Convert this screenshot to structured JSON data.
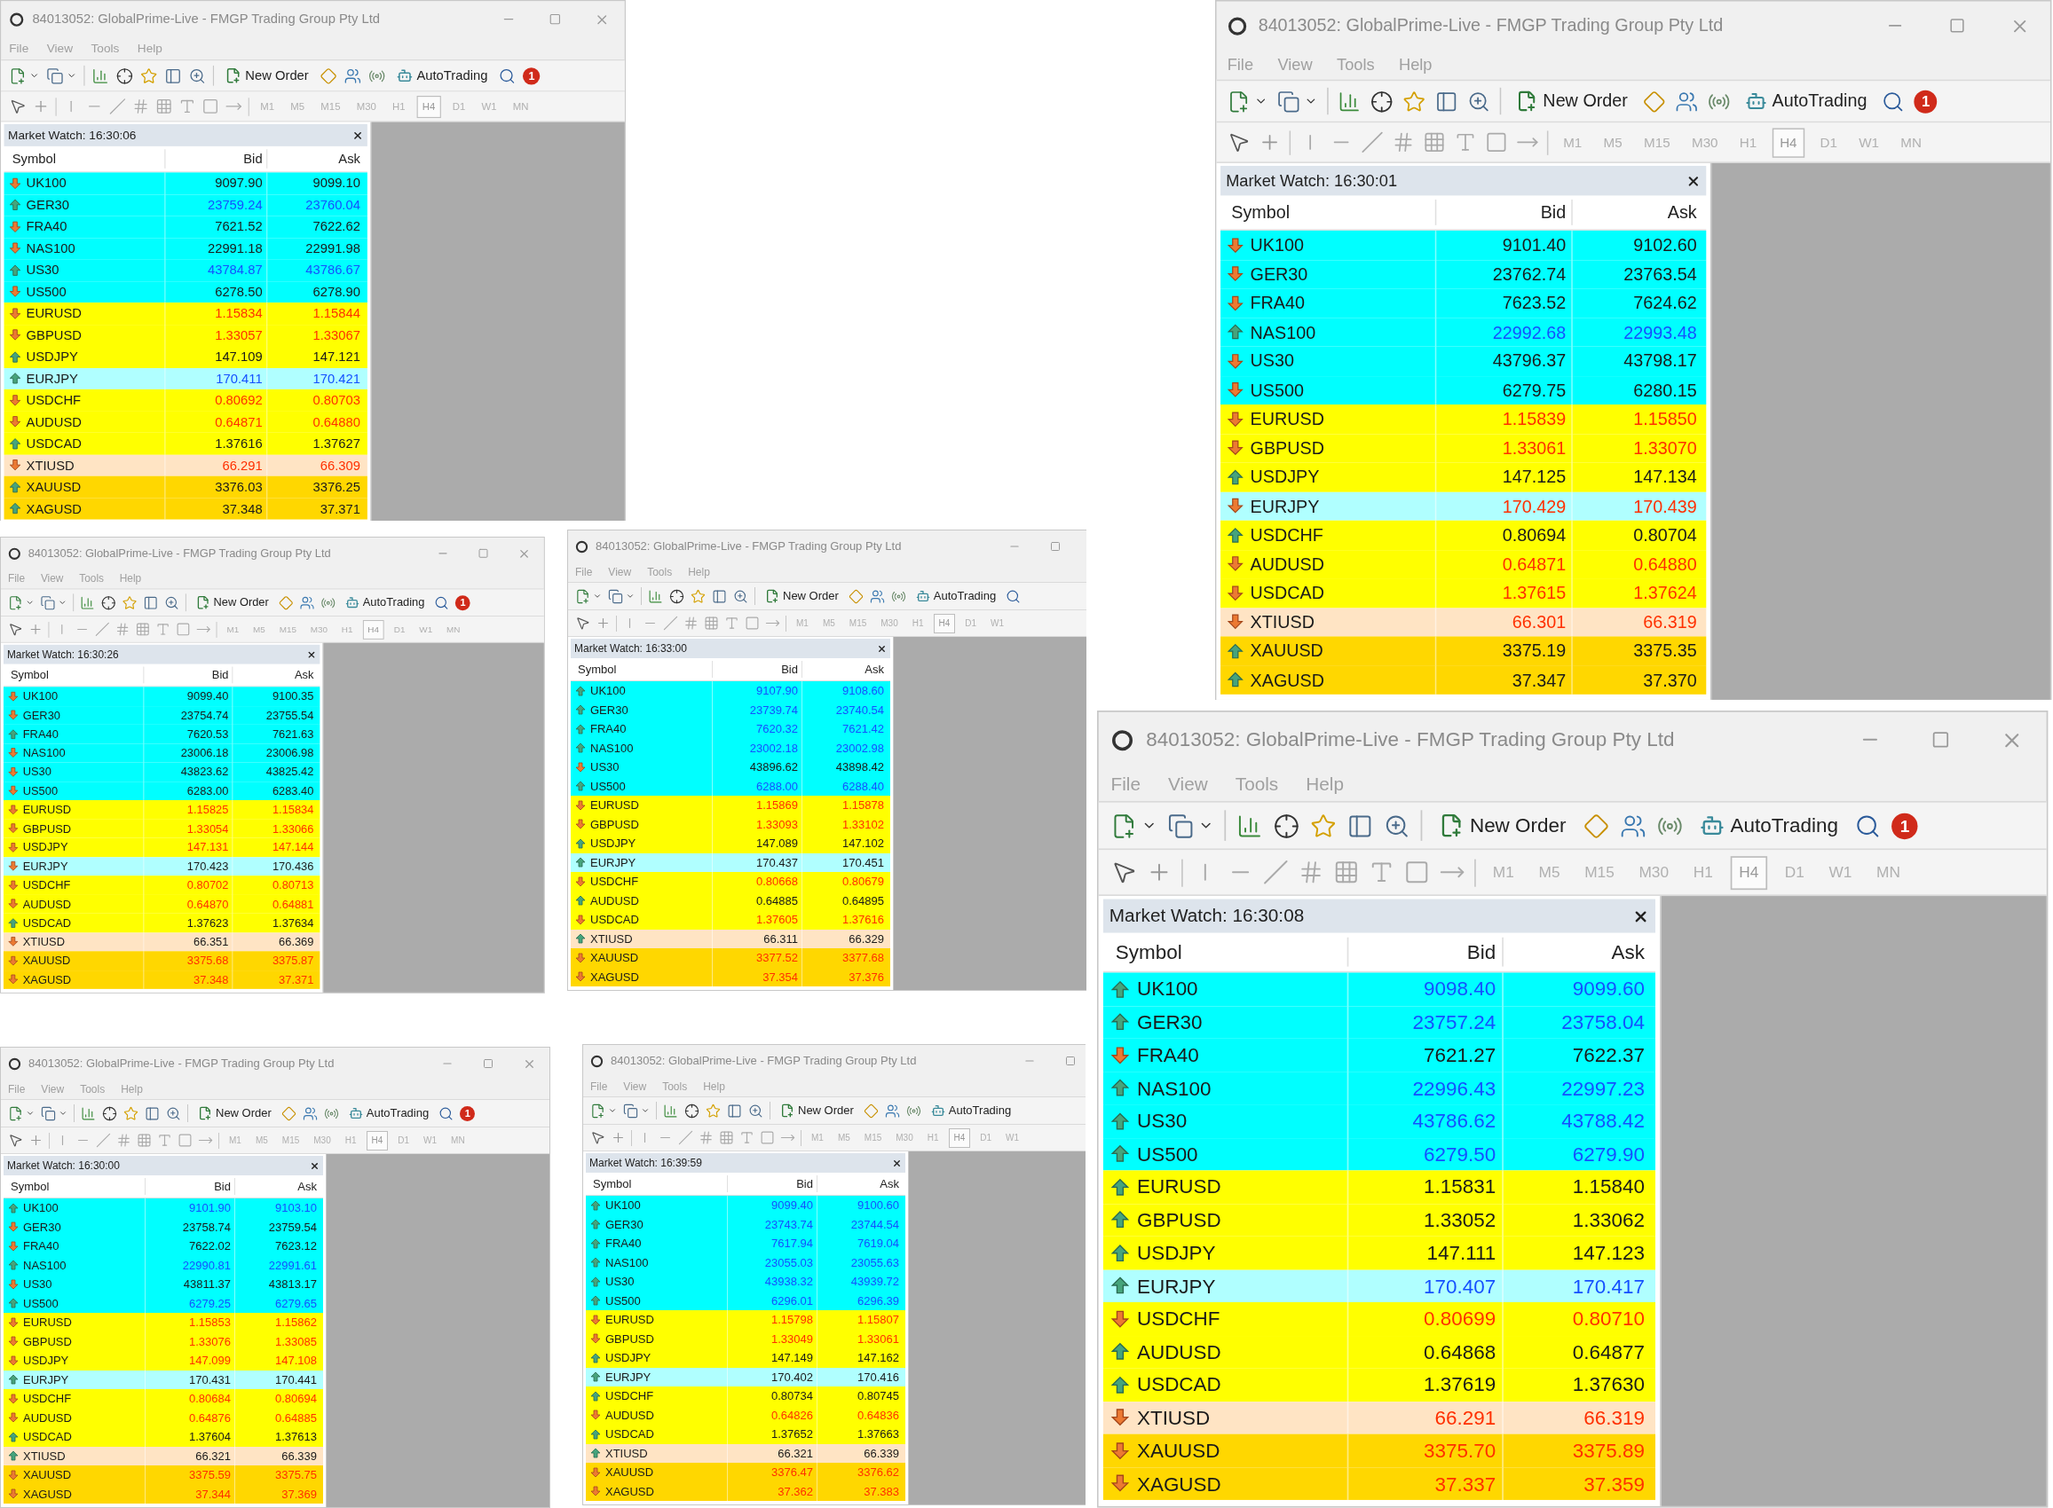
{
  "windows": [
    {
      "title": "84013052: GlobalPrime-Live - FMGP Trading Group Pty Ltd",
      "close_button": true,
      "menu": [
        "File",
        "View",
        "Tools",
        "Help"
      ],
      "toolbar": {
        "new_order": "New Order",
        "autotrading": "AutoTrading",
        "search_button": true,
        "badge": "1"
      },
      "timeframes": [
        {
          "label": "M1",
          "selected": false
        },
        {
          "label": "M5",
          "selected": false
        },
        {
          "label": "M15",
          "selected": false
        },
        {
          "label": "M30",
          "selected": false
        },
        {
          "label": "H1",
          "selected": false
        },
        {
          "label": "H4",
          "selected": true
        },
        {
          "label": "D1",
          "selected": false
        },
        {
          "label": "W1",
          "selected": false
        },
        {
          "label": "MN",
          "selected": false
        }
      ],
      "market_watch": {
        "title": "Market Watch: 16:30:06",
        "columns": [
          "Symbol",
          "Bid",
          "Ask"
        ],
        "rows": [
          {
            "symbol": "UK100",
            "bid": "9097.90",
            "ask": "9099.10",
            "arrow_up": false,
            "price_up": false,
            "price_down": false,
            "color": "#00ffff"
          },
          {
            "symbol": "GER30",
            "bid": "23759.24",
            "ask": "23760.04",
            "arrow_up": true,
            "price_up": true,
            "price_down": false,
            "color": "#00ffff"
          },
          {
            "symbol": "FRA40",
            "bid": "7621.52",
            "ask": "7622.62",
            "arrow_up": false,
            "price_up": false,
            "price_down": false,
            "color": "#00ffff"
          },
          {
            "symbol": "NAS100",
            "bid": "22991.18",
            "ask": "22991.98",
            "arrow_up": false,
            "price_up": false,
            "price_down": false,
            "color": "#00ffff"
          },
          {
            "symbol": "US30",
            "bid": "43784.87",
            "ask": "43786.67",
            "arrow_up": true,
            "price_up": true,
            "price_down": false,
            "color": "#00ffff"
          },
          {
            "symbol": "US500",
            "bid": "6278.50",
            "ask": "6278.90",
            "arrow_up": false,
            "price_up": false,
            "price_down": false,
            "color": "#00ffff"
          },
          {
            "symbol": "EURUSD",
            "bid": "1.15834",
            "ask": "1.15844",
            "arrow_up": false,
            "price_up": false,
            "price_down": true,
            "color": "#ffff00"
          },
          {
            "symbol": "GBPUSD",
            "bid": "1.33057",
            "ask": "1.33067",
            "arrow_up": false,
            "price_up": false,
            "price_down": true,
            "color": "#ffff00"
          },
          {
            "symbol": "USDJPY",
            "bid": "147.109",
            "ask": "147.121",
            "arrow_up": true,
            "price_up": false,
            "price_down": false,
            "color": "#ffff00"
          },
          {
            "symbol": "EURJPY",
            "bid": "170.411",
            "ask": "170.421",
            "arrow_up": true,
            "price_up": true,
            "price_down": false,
            "color": "#b0ffff"
          },
          {
            "symbol": "USDCHF",
            "bid": "0.80692",
            "ask": "0.80703",
            "arrow_up": false,
            "price_up": false,
            "price_down": true,
            "color": "#ffff00"
          },
          {
            "symbol": "AUDUSD",
            "bid": "0.64871",
            "ask": "0.64880",
            "arrow_up": false,
            "price_up": false,
            "price_down": true,
            "color": "#ffff00"
          },
          {
            "symbol": "USDCAD",
            "bid": "1.37616",
            "ask": "1.37627",
            "arrow_up": true,
            "price_up": false,
            "price_down": false,
            "color": "#ffff00"
          },
          {
            "symbol": "XTIUSD",
            "bid": "66.291",
            "ask": "66.309",
            "arrow_up": false,
            "price_up": false,
            "price_down": true,
            "color": "#ffe4c4"
          },
          {
            "symbol": "XAUUSD",
            "bid": "3376.03",
            "ask": "3376.25",
            "arrow_up": true,
            "price_up": false,
            "price_down": false,
            "color": "#ffd700"
          },
          {
            "symbol": "XAGUSD",
            "bid": "37.348",
            "ask": "37.371",
            "arrow_up": true,
            "price_up": false,
            "price_down": false,
            "color": "#ffd700"
          }
        ]
      }
    },
    {
      "title": "84013052: GlobalPrime-Live - FMGP Trading Group Pty Ltd",
      "close_button": true,
      "menu": [
        "File",
        "View",
        "Tools",
        "Help"
      ],
      "toolbar": {
        "new_order": "New Order",
        "autotrading": "AutoTrading",
        "search_button": true,
        "badge": "1"
      },
      "timeframes": [
        {
          "label": "M1",
          "selected": false
        },
        {
          "label": "M5",
          "selected": false
        },
        {
          "label": "M15",
          "selected": false
        },
        {
          "label": "M30",
          "selected": false
        },
        {
          "label": "H1",
          "selected": false
        },
        {
          "label": "H4",
          "selected": true
        },
        {
          "label": "D1",
          "selected": false
        },
        {
          "label": "W1",
          "selected": false
        },
        {
          "label": "MN",
          "selected": false
        }
      ],
      "market_watch": {
        "title": "Market Watch: 16:30:01",
        "columns": [
          "Symbol",
          "Bid",
          "Ask"
        ],
        "rows": [
          {
            "symbol": "UK100",
            "bid": "9101.40",
            "ask": "9102.60",
            "arrow_up": false,
            "price_up": false,
            "price_down": false,
            "color": "#00ffff"
          },
          {
            "symbol": "GER30",
            "bid": "23762.74",
            "ask": "23763.54",
            "arrow_up": false,
            "price_up": false,
            "price_down": false,
            "color": "#00ffff"
          },
          {
            "symbol": "FRA40",
            "bid": "7623.52",
            "ask": "7624.62",
            "arrow_up": false,
            "price_up": false,
            "price_down": false,
            "color": "#00ffff"
          },
          {
            "symbol": "NAS100",
            "bid": "22992.68",
            "ask": "22993.48",
            "arrow_up": true,
            "price_up": true,
            "price_down": false,
            "color": "#00ffff"
          },
          {
            "symbol": "US30",
            "bid": "43796.37",
            "ask": "43798.17",
            "arrow_up": false,
            "price_up": false,
            "price_down": false,
            "color": "#00ffff"
          },
          {
            "symbol": "US500",
            "bid": "6279.75",
            "ask": "6280.15",
            "arrow_up": false,
            "price_up": false,
            "price_down": false,
            "color": "#00ffff"
          },
          {
            "symbol": "EURUSD",
            "bid": "1.15839",
            "ask": "1.15850",
            "arrow_up": false,
            "price_up": false,
            "price_down": true,
            "color": "#ffff00"
          },
          {
            "symbol": "GBPUSD",
            "bid": "1.33061",
            "ask": "1.33070",
            "arrow_up": false,
            "price_up": false,
            "price_down": true,
            "color": "#ffff00"
          },
          {
            "symbol": "USDJPY",
            "bid": "147.125",
            "ask": "147.134",
            "arrow_up": true,
            "price_up": false,
            "price_down": false,
            "color": "#ffff00"
          },
          {
            "symbol": "EURJPY",
            "bid": "170.429",
            "ask": "170.439",
            "arrow_up": false,
            "price_up": false,
            "price_down": true,
            "color": "#b0ffff"
          },
          {
            "symbol": "USDCHF",
            "bid": "0.80694",
            "ask": "0.80704",
            "arrow_up": true,
            "price_up": false,
            "price_down": false,
            "color": "#ffff00"
          },
          {
            "symbol": "AUDUSD",
            "bid": "0.64871",
            "ask": "0.64880",
            "arrow_up": false,
            "price_up": false,
            "price_down": true,
            "color": "#ffff00"
          },
          {
            "symbol": "USDCAD",
            "bid": "1.37615",
            "ask": "1.37624",
            "arrow_up": false,
            "price_up": false,
            "price_down": true,
            "color": "#ffff00"
          },
          {
            "symbol": "XTIUSD",
            "bid": "66.301",
            "ask": "66.319",
            "arrow_up": false,
            "price_up": false,
            "price_down": true,
            "color": "#ffe4c4"
          },
          {
            "symbol": "XAUUSD",
            "bid": "3375.19",
            "ask": "3375.35",
            "arrow_up": true,
            "price_up": false,
            "price_down": false,
            "color": "#ffd700"
          },
          {
            "symbol": "XAGUSD",
            "bid": "37.347",
            "ask": "37.370",
            "arrow_up": true,
            "price_up": false,
            "price_down": false,
            "color": "#ffd700"
          }
        ]
      }
    },
    {
      "title": "84013052: GlobalPrime-Live - FMGP Trading Group Pty Ltd",
      "close_button": true,
      "menu": [
        "File",
        "View",
        "Tools",
        "Help"
      ],
      "toolbar": {
        "new_order": "New Order",
        "autotrading": "AutoTrading",
        "search_button": true,
        "badge": "1"
      },
      "timeframes": [
        {
          "label": "M1",
          "selected": false
        },
        {
          "label": "M5",
          "selected": false
        },
        {
          "label": "M15",
          "selected": false
        },
        {
          "label": "M30",
          "selected": false
        },
        {
          "label": "H1",
          "selected": false
        },
        {
          "label": "H4",
          "selected": true
        },
        {
          "label": "D1",
          "selected": false
        },
        {
          "label": "W1",
          "selected": false
        },
        {
          "label": "MN",
          "selected": false
        }
      ],
      "market_watch": {
        "title": "Market Watch: 16:30:26",
        "columns": [
          "Symbol",
          "Bid",
          "Ask"
        ],
        "rows": [
          {
            "symbol": "UK100",
            "bid": "9099.40",
            "ask": "9100.35",
            "arrow_up": false,
            "price_up": false,
            "price_down": false,
            "color": "#00ffff"
          },
          {
            "symbol": "GER30",
            "bid": "23754.74",
            "ask": "23755.54",
            "arrow_up": false,
            "price_up": false,
            "price_down": false,
            "color": "#00ffff"
          },
          {
            "symbol": "FRA40",
            "bid": "7620.53",
            "ask": "7621.63",
            "arrow_up": true,
            "price_up": false,
            "price_down": false,
            "color": "#00ffff"
          },
          {
            "symbol": "NAS100",
            "bid": "23006.18",
            "ask": "23006.98",
            "arrow_up": false,
            "price_up": false,
            "price_down": false,
            "color": "#00ffff"
          },
          {
            "symbol": "US30",
            "bid": "43823.62",
            "ask": "43825.42",
            "arrow_up": false,
            "price_up": false,
            "price_down": false,
            "color": "#00ffff"
          },
          {
            "symbol": "US500",
            "bid": "6283.00",
            "ask": "6283.40",
            "arrow_up": false,
            "price_up": false,
            "price_down": false,
            "color": "#00ffff"
          },
          {
            "symbol": "EURUSD",
            "bid": "1.15825",
            "ask": "1.15834",
            "arrow_up": false,
            "price_up": false,
            "price_down": true,
            "color": "#ffff00"
          },
          {
            "symbol": "GBPUSD",
            "bid": "1.33054",
            "ask": "1.33066",
            "arrow_up": false,
            "price_up": false,
            "price_down": true,
            "color": "#ffff00"
          },
          {
            "symbol": "USDJPY",
            "bid": "147.131",
            "ask": "147.144",
            "arrow_up": false,
            "price_up": false,
            "price_down": true,
            "color": "#ffff00"
          },
          {
            "symbol": "EURJPY",
            "bid": "170.423",
            "ask": "170.436",
            "arrow_up": false,
            "price_up": false,
            "price_down": false,
            "color": "#b0ffff"
          },
          {
            "symbol": "USDCHF",
            "bid": "0.80702",
            "ask": "0.80713",
            "arrow_up": false,
            "price_up": false,
            "price_down": true,
            "color": "#ffff00"
          },
          {
            "symbol": "AUDUSD",
            "bid": "0.64870",
            "ask": "0.64881",
            "arrow_up": false,
            "price_up": false,
            "price_down": true,
            "color": "#ffff00"
          },
          {
            "symbol": "USDCAD",
            "bid": "1.37623",
            "ask": "1.37634",
            "arrow_up": true,
            "price_up": false,
            "price_down": false,
            "color": "#ffff00"
          },
          {
            "symbol": "XTIUSD",
            "bid": "66.351",
            "ask": "66.369",
            "arrow_up": false,
            "price_up": false,
            "price_down": false,
            "color": "#ffe4c4"
          },
          {
            "symbol": "XAUUSD",
            "bid": "3375.68",
            "ask": "3375.87",
            "arrow_up": false,
            "price_up": false,
            "price_down": true,
            "color": "#ffd700"
          },
          {
            "symbol": "XAGUSD",
            "bid": "37.348",
            "ask": "37.371",
            "arrow_up": false,
            "price_up": false,
            "price_down": true,
            "color": "#ffd700"
          }
        ]
      }
    },
    {
      "title": "84013052: GlobalPrime-Live - FMGP Trading Group Pty Ltd",
      "close_button": false,
      "menu": [
        "File",
        "View",
        "Tools",
        "Help"
      ],
      "toolbar": {
        "new_order": "New Order",
        "autotrading": "AutoTrading",
        "search_button": true
      },
      "timeframes": [
        {
          "label": "M1",
          "selected": false
        },
        {
          "label": "M5",
          "selected": false
        },
        {
          "label": "M15",
          "selected": false
        },
        {
          "label": "M30",
          "selected": false
        },
        {
          "label": "H1",
          "selected": false
        },
        {
          "label": "H4",
          "selected": true
        },
        {
          "label": "D1",
          "selected": false
        },
        {
          "label": "W1",
          "selected": false
        }
      ],
      "market_watch": {
        "title": "Market Watch: 16:33:00",
        "columns": [
          "Symbol",
          "Bid",
          "Ask"
        ],
        "rows": [
          {
            "symbol": "UK100",
            "bid": "9107.90",
            "ask": "9108.60",
            "arrow_up": true,
            "price_up": true,
            "price_down": false,
            "color": "#00ffff"
          },
          {
            "symbol": "GER30",
            "bid": "23739.74",
            "ask": "23740.54",
            "arrow_up": true,
            "price_up": true,
            "price_down": false,
            "color": "#00ffff"
          },
          {
            "symbol": "FRA40",
            "bid": "7620.32",
            "ask": "7621.42",
            "arrow_up": true,
            "price_up": true,
            "price_down": false,
            "color": "#00ffff"
          },
          {
            "symbol": "NAS100",
            "bid": "23002.18",
            "ask": "23002.98",
            "arrow_up": true,
            "price_up": true,
            "price_down": false,
            "color": "#00ffff"
          },
          {
            "symbol": "US30",
            "bid": "43896.62",
            "ask": "43898.42",
            "arrow_up": false,
            "price_up": false,
            "price_down": false,
            "color": "#00ffff"
          },
          {
            "symbol": "US500",
            "bid": "6288.00",
            "ask": "6288.40",
            "arrow_up": true,
            "price_up": true,
            "price_down": false,
            "color": "#00ffff"
          },
          {
            "symbol": "EURUSD",
            "bid": "1.15869",
            "ask": "1.15878",
            "arrow_up": false,
            "price_up": false,
            "price_down": true,
            "color": "#ffff00"
          },
          {
            "symbol": "GBPUSD",
            "bid": "1.33093",
            "ask": "1.33102",
            "arrow_up": false,
            "price_up": false,
            "price_down": true,
            "color": "#ffff00"
          },
          {
            "symbol": "USDJPY",
            "bid": "147.089",
            "ask": "147.102",
            "arrow_up": true,
            "price_up": false,
            "price_down": false,
            "color": "#ffff00"
          },
          {
            "symbol": "EURJPY",
            "bid": "170.437",
            "ask": "170.451",
            "arrow_up": true,
            "price_up": false,
            "price_down": false,
            "color": "#b0ffff"
          },
          {
            "symbol": "USDCHF",
            "bid": "0.80668",
            "ask": "0.80679",
            "arrow_up": false,
            "price_up": false,
            "price_down": true,
            "color": "#ffff00"
          },
          {
            "symbol": "AUDUSD",
            "bid": "0.64885",
            "ask": "0.64895",
            "arrow_up": true,
            "price_up": false,
            "price_down": false,
            "color": "#ffff00"
          },
          {
            "symbol": "USDCAD",
            "bid": "1.37605",
            "ask": "1.37616",
            "arrow_up": false,
            "price_up": false,
            "price_down": true,
            "color": "#ffff00"
          },
          {
            "symbol": "XTIUSD",
            "bid": "66.311",
            "ask": "66.329",
            "arrow_up": true,
            "price_up": false,
            "price_down": false,
            "color": "#ffe4c4"
          },
          {
            "symbol": "XAUUSD",
            "bid": "3377.52",
            "ask": "3377.68",
            "arrow_up": false,
            "price_up": false,
            "price_down": true,
            "color": "#ffd700"
          },
          {
            "symbol": "XAGUSD",
            "bid": "37.354",
            "ask": "37.376",
            "arrow_up": false,
            "price_up": false,
            "price_down": true,
            "color": "#ffd700"
          }
        ]
      }
    },
    {
      "title": "84013052: GlobalPrime-Live - FMGP Trading Group Pty Ltd",
      "close_button": true,
      "menu": [
        "File",
        "View",
        "Tools",
        "Help"
      ],
      "toolbar": {
        "new_order": "New Order",
        "autotrading": "AutoTrading",
        "search_button": true,
        "badge": "1"
      },
      "timeframes": [
        {
          "label": "M1",
          "selected": false
        },
        {
          "label": "M5",
          "selected": false
        },
        {
          "label": "M15",
          "selected": false
        },
        {
          "label": "M30",
          "selected": false
        },
        {
          "label": "H1",
          "selected": false
        },
        {
          "label": "H4",
          "selected": true
        },
        {
          "label": "D1",
          "selected": false
        },
        {
          "label": "W1",
          "selected": false
        },
        {
          "label": "MN",
          "selected": false
        }
      ],
      "market_watch": {
        "title": "Market Watch: 16:30:00",
        "columns": [
          "Symbol",
          "Bid",
          "Ask"
        ],
        "rows": [
          {
            "symbol": "UK100",
            "bid": "9101.90",
            "ask": "9103.10",
            "arrow_up": true,
            "price_up": true,
            "price_down": false,
            "color": "#00ffff"
          },
          {
            "symbol": "GER30",
            "bid": "23758.74",
            "ask": "23759.54",
            "arrow_up": false,
            "price_up": false,
            "price_down": false,
            "color": "#00ffff"
          },
          {
            "symbol": "FRA40",
            "bid": "7622.02",
            "ask": "7623.12",
            "arrow_up": false,
            "price_up": false,
            "price_down": false,
            "color": "#00ffff"
          },
          {
            "symbol": "NAS100",
            "bid": "22990.81",
            "ask": "22991.61",
            "arrow_up": true,
            "price_up": true,
            "price_down": false,
            "color": "#00ffff"
          },
          {
            "symbol": "US30",
            "bid": "43811.37",
            "ask": "43813.17",
            "arrow_up": false,
            "price_up": false,
            "price_down": false,
            "color": "#00ffff"
          },
          {
            "symbol": "US500",
            "bid": "6279.25",
            "ask": "6279.65",
            "arrow_up": true,
            "price_up": true,
            "price_down": false,
            "color": "#00ffff"
          },
          {
            "symbol": "EURUSD",
            "bid": "1.15853",
            "ask": "1.15862",
            "arrow_up": false,
            "price_up": false,
            "price_down": true,
            "color": "#ffff00"
          },
          {
            "symbol": "GBPUSD",
            "bid": "1.33076",
            "ask": "1.33085",
            "arrow_up": false,
            "price_up": false,
            "price_down": true,
            "color": "#ffff00"
          },
          {
            "symbol": "USDJPY",
            "bid": "147.099",
            "ask": "147.108",
            "arrow_up": false,
            "price_up": false,
            "price_down": true,
            "color": "#ffff00"
          },
          {
            "symbol": "EURJPY",
            "bid": "170.431",
            "ask": "170.441",
            "arrow_up": true,
            "price_up": false,
            "price_down": false,
            "color": "#b0ffff"
          },
          {
            "symbol": "USDCHF",
            "bid": "0.80684",
            "ask": "0.80694",
            "arrow_up": false,
            "price_up": false,
            "price_down": true,
            "color": "#ffff00"
          },
          {
            "symbol": "AUDUSD",
            "bid": "0.64876",
            "ask": "0.64885",
            "arrow_up": false,
            "price_up": false,
            "price_down": true,
            "color": "#ffff00"
          },
          {
            "symbol": "USDCAD",
            "bid": "1.37604",
            "ask": "1.37613",
            "arrow_up": true,
            "price_up": false,
            "price_down": false,
            "color": "#ffff00"
          },
          {
            "symbol": "XTIUSD",
            "bid": "66.321",
            "ask": "66.339",
            "arrow_up": true,
            "price_up": false,
            "price_down": false,
            "color": "#ffe4c4"
          },
          {
            "symbol": "XAUUSD",
            "bid": "3375.59",
            "ask": "3375.75",
            "arrow_up": false,
            "price_up": false,
            "price_down": true,
            "color": "#ffd700"
          },
          {
            "symbol": "XAGUSD",
            "bid": "37.344",
            "ask": "37.369",
            "arrow_up": false,
            "price_up": false,
            "price_down": true,
            "color": "#ffd700"
          }
        ]
      }
    },
    {
      "title": "84013052: GlobalPrime-Live - FMGP Trading Group Pty Ltd",
      "close_button": false,
      "menu": [
        "File",
        "View",
        "Tools",
        "Help"
      ],
      "toolbar": {
        "new_order": "New Order",
        "autotrading": "AutoTrading",
        "search_button": false
      },
      "timeframes": [
        {
          "label": "M1",
          "selected": false
        },
        {
          "label": "M5",
          "selected": false
        },
        {
          "label": "M15",
          "selected": false
        },
        {
          "label": "M30",
          "selected": false
        },
        {
          "label": "H1",
          "selected": false
        },
        {
          "label": "H4",
          "selected": true
        },
        {
          "label": "D1",
          "selected": false
        },
        {
          "label": "W1",
          "selected": false
        }
      ],
      "market_watch": {
        "title": "Market Watch: 16:39:59",
        "columns": [
          "Symbol",
          "Bid",
          "Ask"
        ],
        "rows": [
          {
            "symbol": "UK100",
            "bid": "9099.40",
            "ask": "9100.60",
            "arrow_up": true,
            "price_up": true,
            "price_down": false,
            "color": "#00ffff"
          },
          {
            "symbol": "GER30",
            "bid": "23743.74",
            "ask": "23744.54",
            "arrow_up": true,
            "price_up": true,
            "price_down": false,
            "color": "#00ffff"
          },
          {
            "symbol": "FRA40",
            "bid": "7617.94",
            "ask": "7619.04",
            "arrow_up": true,
            "price_up": true,
            "price_down": false,
            "color": "#00ffff"
          },
          {
            "symbol": "NAS100",
            "bid": "23055.03",
            "ask": "23055.63",
            "arrow_up": true,
            "price_up": true,
            "price_down": false,
            "color": "#00ffff"
          },
          {
            "symbol": "US30",
            "bid": "43938.32",
            "ask": "43939.72",
            "arrow_up": true,
            "price_up": true,
            "price_down": false,
            "color": "#00ffff"
          },
          {
            "symbol": "US500",
            "bid": "6296.01",
            "ask": "6296.39",
            "arrow_up": true,
            "price_up": true,
            "price_down": false,
            "color": "#00ffff"
          },
          {
            "symbol": "EURUSD",
            "bid": "1.15798",
            "ask": "1.15807",
            "arrow_up": false,
            "price_up": false,
            "price_down": true,
            "color": "#ffff00"
          },
          {
            "symbol": "GBPUSD",
            "bid": "1.33049",
            "ask": "1.33061",
            "arrow_up": false,
            "price_up": false,
            "price_down": true,
            "color": "#ffff00"
          },
          {
            "symbol": "USDJPY",
            "bid": "147.149",
            "ask": "147.162",
            "arrow_up": true,
            "price_up": false,
            "price_down": false,
            "color": "#ffff00"
          },
          {
            "symbol": "EURJPY",
            "bid": "170.402",
            "ask": "170.416",
            "arrow_up": true,
            "price_up": false,
            "price_down": false,
            "color": "#b0ffff"
          },
          {
            "symbol": "USDCHF",
            "bid": "0.80734",
            "ask": "0.80745",
            "arrow_up": true,
            "price_up": false,
            "price_down": false,
            "color": "#ffff00"
          },
          {
            "symbol": "AUDUSD",
            "bid": "0.64826",
            "ask": "0.64836",
            "arrow_up": false,
            "price_up": false,
            "price_down": true,
            "color": "#ffff00"
          },
          {
            "symbol": "USDCAD",
            "bid": "1.37652",
            "ask": "1.37663",
            "arrow_up": true,
            "price_up": false,
            "price_down": false,
            "color": "#ffff00"
          },
          {
            "symbol": "XTIUSD",
            "bid": "66.321",
            "ask": "66.339",
            "arrow_up": true,
            "price_up": false,
            "price_down": false,
            "color": "#ffe4c4"
          },
          {
            "symbol": "XAUUSD",
            "bid": "3376.47",
            "ask": "3376.62",
            "arrow_up": false,
            "price_up": false,
            "price_down": true,
            "color": "#ffd700"
          },
          {
            "symbol": "XAGUSD",
            "bid": "37.362",
            "ask": "37.383",
            "arrow_up": false,
            "price_up": false,
            "price_down": true,
            "color": "#ffd700"
          }
        ]
      }
    },
    {
      "title": "84013052: GlobalPrime-Live - FMGP Trading Group Pty Ltd",
      "close_button": true,
      "menu": [
        "File",
        "View",
        "Tools",
        "Help"
      ],
      "toolbar": {
        "new_order": "New Order",
        "autotrading": "AutoTrading",
        "search_button": true,
        "badge": "1"
      },
      "timeframes": [
        {
          "label": "M1",
          "selected": false
        },
        {
          "label": "M5",
          "selected": false
        },
        {
          "label": "M15",
          "selected": false
        },
        {
          "label": "M30",
          "selected": false
        },
        {
          "label": "H1",
          "selected": false
        },
        {
          "label": "H4",
          "selected": true
        },
        {
          "label": "D1",
          "selected": false
        },
        {
          "label": "W1",
          "selected": false
        },
        {
          "label": "MN",
          "selected": false
        }
      ],
      "market_watch": {
        "title": "Market Watch: 16:30:08",
        "columns": [
          "Symbol",
          "Bid",
          "Ask"
        ],
        "rows": [
          {
            "symbol": "UK100",
            "bid": "9098.40",
            "ask": "9099.60",
            "arrow_up": true,
            "price_up": true,
            "price_down": false,
            "color": "#00ffff"
          },
          {
            "symbol": "GER30",
            "bid": "23757.24",
            "ask": "23758.04",
            "arrow_up": true,
            "price_up": true,
            "price_down": false,
            "color": "#00ffff"
          },
          {
            "symbol": "FRA40",
            "bid": "7621.27",
            "ask": "7622.37",
            "arrow_up": false,
            "price_up": false,
            "price_down": false,
            "color": "#00ffff"
          },
          {
            "symbol": "NAS100",
            "bid": "22996.43",
            "ask": "22997.23",
            "arrow_up": true,
            "price_up": true,
            "price_down": false,
            "color": "#00ffff"
          },
          {
            "symbol": "US30",
            "bid": "43786.62",
            "ask": "43788.42",
            "arrow_up": true,
            "price_up": true,
            "price_down": false,
            "color": "#00ffff"
          },
          {
            "symbol": "US500",
            "bid": "6279.50",
            "ask": "6279.90",
            "arrow_up": true,
            "price_up": true,
            "price_down": false,
            "color": "#00ffff"
          },
          {
            "symbol": "EURUSD",
            "bid": "1.15831",
            "ask": "1.15840",
            "arrow_up": true,
            "price_up": false,
            "price_down": false,
            "color": "#ffff00"
          },
          {
            "symbol": "GBPUSD",
            "bid": "1.33052",
            "ask": "1.33062",
            "arrow_up": true,
            "price_up": false,
            "price_down": false,
            "color": "#ffff00"
          },
          {
            "symbol": "USDJPY",
            "bid": "147.111",
            "ask": "147.123",
            "arrow_up": true,
            "price_up": false,
            "price_down": false,
            "color": "#ffff00"
          },
          {
            "symbol": "EURJPY",
            "bid": "170.407",
            "ask": "170.417",
            "arrow_up": true,
            "price_up": true,
            "price_down": false,
            "color": "#b0ffff"
          },
          {
            "symbol": "USDCHF",
            "bid": "0.80699",
            "ask": "0.80710",
            "arrow_up": false,
            "price_up": false,
            "price_down": true,
            "color": "#ffff00"
          },
          {
            "symbol": "AUDUSD",
            "bid": "0.64868",
            "ask": "0.64877",
            "arrow_up": true,
            "price_up": false,
            "price_down": false,
            "color": "#ffff00"
          },
          {
            "symbol": "USDCAD",
            "bid": "1.37619",
            "ask": "1.37630",
            "arrow_up": true,
            "price_up": false,
            "price_down": false,
            "color": "#ffff00"
          },
          {
            "symbol": "XTIUSD",
            "bid": "66.291",
            "ask": "66.319",
            "arrow_up": false,
            "price_up": false,
            "price_down": true,
            "color": "#ffe4c4"
          },
          {
            "symbol": "XAUUSD",
            "bid": "3375.70",
            "ask": "3375.89",
            "arrow_up": false,
            "price_up": false,
            "price_down": true,
            "color": "#ffd700"
          },
          {
            "symbol": "XAGUSD",
            "bid": "37.337",
            "ask": "37.359",
            "arrow_up": false,
            "price_up": false,
            "price_down": true,
            "color": "#ffd700"
          }
        ]
      }
    }
  ]
}
